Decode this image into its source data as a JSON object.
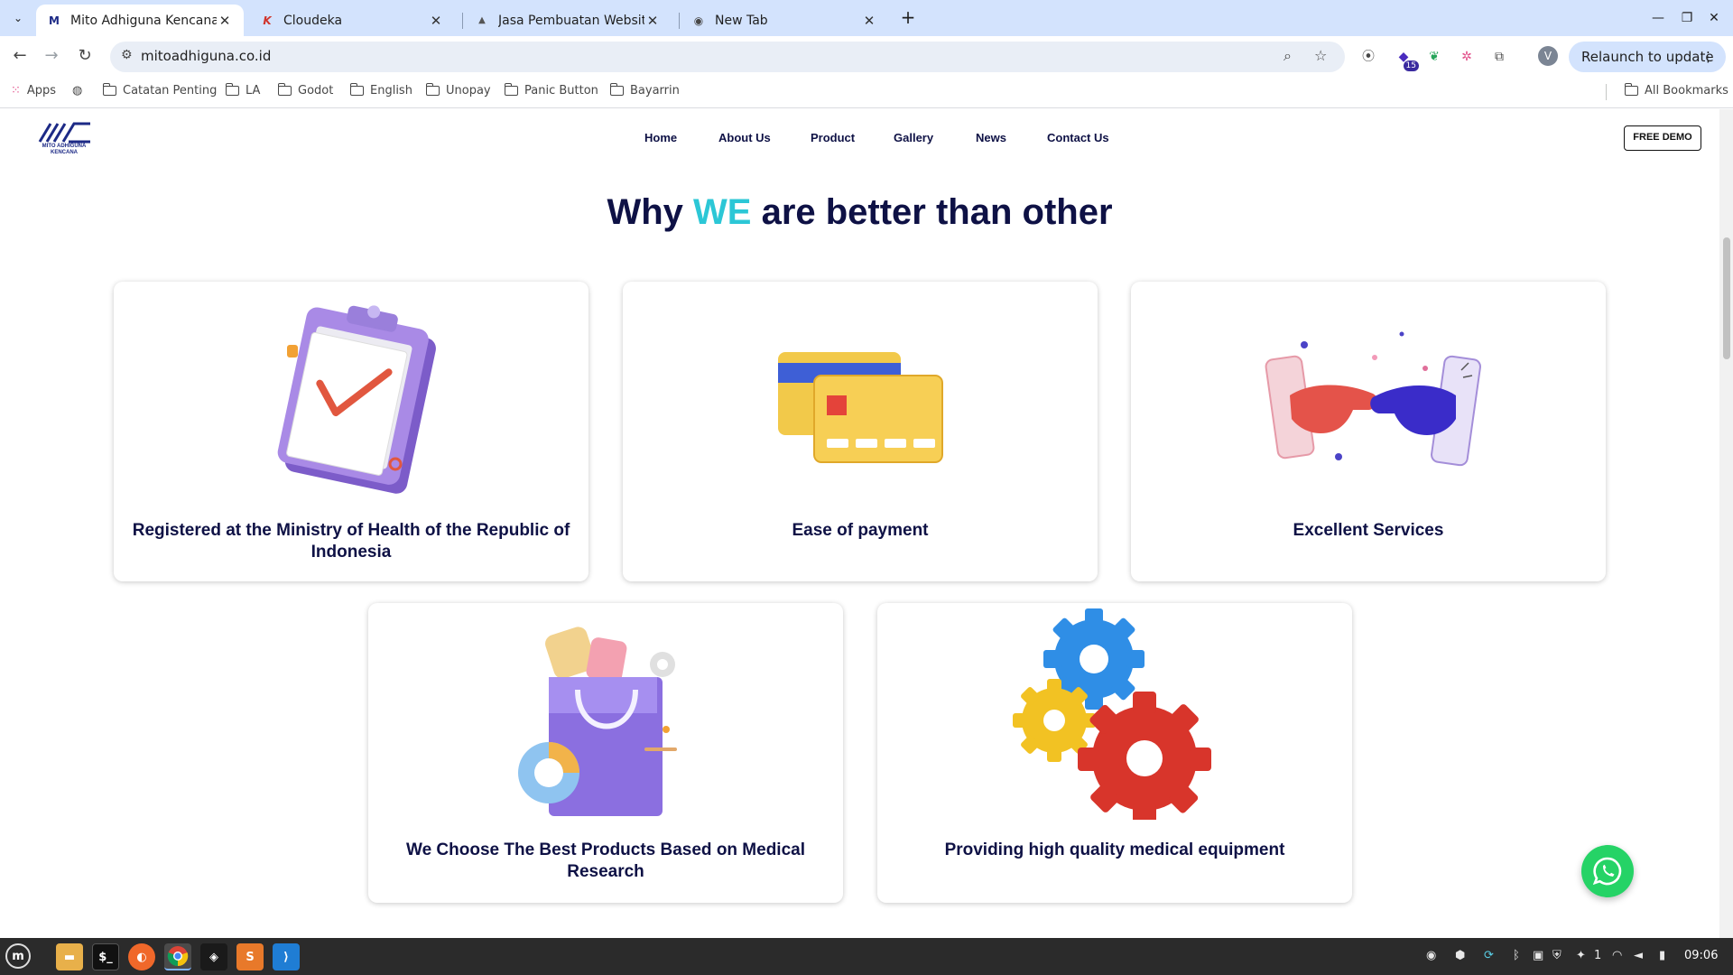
{
  "browser": {
    "tabs": [
      {
        "title": "Mito Adhiguna Kencana",
        "active": true
      },
      {
        "title": "Cloudeka",
        "active": false
      },
      {
        "title": "Jasa Pembuatan Website Pe",
        "active": false
      },
      {
        "title": "New Tab",
        "active": false
      }
    ],
    "url": "mitoadhiguna.co.id",
    "relaunch_label": "Relaunch to update",
    "profile_initial": "V",
    "extension_badge": "15",
    "bookmarks": [
      "Apps",
      "Catatan Penting",
      "LA",
      "Godot",
      "English",
      "Unopay",
      "Panic Button",
      "Bayarrin"
    ],
    "all_bookmarks_label": "All Bookmarks"
  },
  "site": {
    "logo_text": "MITO ADHIGUNA KENCANA",
    "nav": [
      "Home",
      "About Us",
      "Product",
      "Gallery",
      "News",
      "Contact Us"
    ],
    "demo_button": "FREE DEMO",
    "headline": {
      "prefix": "Why ",
      "highlight": "WE",
      "suffix": " are better than other"
    },
    "cards": [
      {
        "caption": "Registered at the Ministry of Health of the Republic of Indonesia",
        "icon": "clipboard-check-icon"
      },
      {
        "caption": "Ease of payment",
        "icon": "credit-card-icon"
      },
      {
        "caption": "Excellent Services",
        "icon": "handshake-icon"
      },
      {
        "caption": "We Choose The Best Products Based on Medical Research",
        "icon": "shopping-bag-icon"
      },
      {
        "caption": "Providing high quality medical equipment",
        "icon": "gears-icon"
      }
    ],
    "accent_color": "#2cc7d6",
    "heading_color": "#0e1145",
    "whatsapp_color": "#25d366"
  },
  "taskbar": {
    "clock": "09:06",
    "tray_count": "1"
  }
}
